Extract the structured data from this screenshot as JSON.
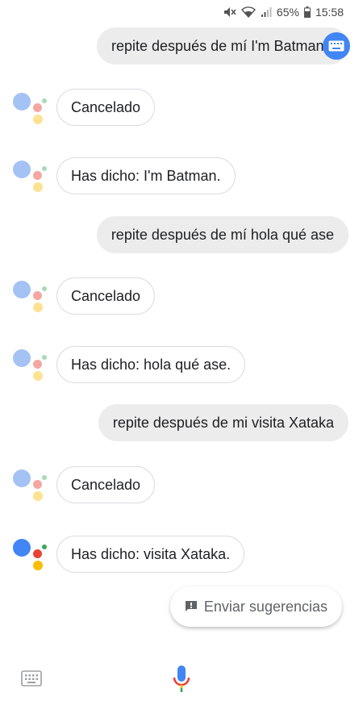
{
  "status_bar": {
    "battery": "65%",
    "time": "15:58",
    "icons": [
      "mute-icon",
      "wifi-icon",
      "signal-icon",
      "battery-icon"
    ]
  },
  "conversation": {
    "messages": [
      {
        "from": "user",
        "text": "repite después de mí I'm Batman."
      },
      {
        "from": "assistant",
        "text": "Cancelado"
      },
      {
        "from": "assistant",
        "text": "Has dicho: I'm Batman."
      },
      {
        "from": "user",
        "text": "repite después de mí hola qué ase"
      },
      {
        "from": "assistant",
        "text": "Cancelado"
      },
      {
        "from": "assistant",
        "text": "Has dicho: hola qué ase."
      },
      {
        "from": "user",
        "text": "repite después de mi visita Xataka"
      },
      {
        "from": "assistant",
        "text": "Cancelado"
      },
      {
        "from": "assistant",
        "text": "Has dicho: visita Xataka."
      }
    ]
  },
  "suggestion": {
    "label": "Enviar sugerencias",
    "icon": "feedback-icon"
  },
  "bottom_bar": {
    "keyboard_icon": "keyboard-icon",
    "mic_icon": "mic-icon"
  },
  "colors": {
    "google_blue": "#4285f4",
    "google_red": "#ea4335",
    "google_yellow": "#fbbc04",
    "google_green": "#34a853",
    "user_bubble": "#ececec",
    "bot_border": "#dadce0"
  }
}
